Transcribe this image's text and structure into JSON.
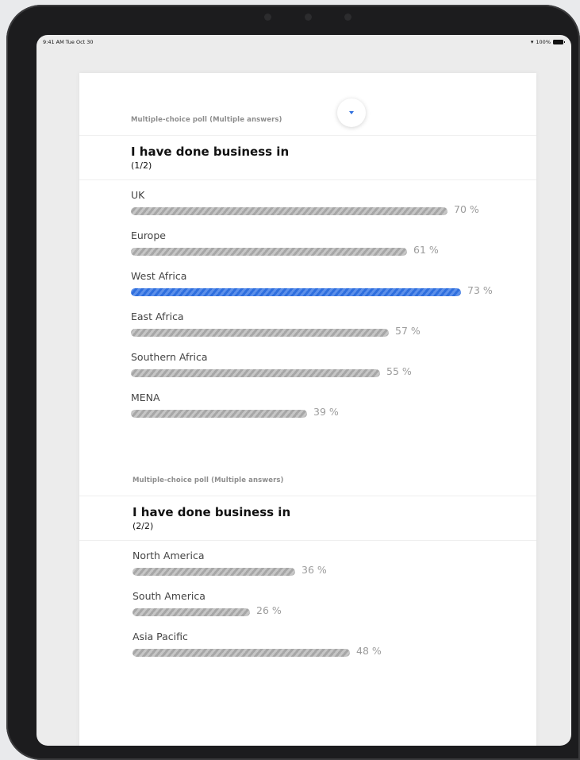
{
  "status_bar": {
    "time": "9:41 AM",
    "date": "Tue Oct 30",
    "battery": "100%",
    "wifi_icon": "wifi-icon",
    "battery_icon": "battery-icon"
  },
  "collapse_icon": "chevron-down-icon",
  "accent_color": "#2f6fde",
  "polls": [
    {
      "type_label": "Multiple-choice poll (Multiple answers)",
      "title": "I have done business in",
      "subtitle": "(1/2)",
      "options": [
        {
          "label": "UK",
          "percent": 70,
          "percent_text": "70 %",
          "selected": false
        },
        {
          "label": "Europe",
          "percent": 61,
          "percent_text": "61 %",
          "selected": false
        },
        {
          "label": "West Africa",
          "percent": 73,
          "percent_text": "73 %",
          "selected": true
        },
        {
          "label": "East Africa",
          "percent": 57,
          "percent_text": "57 %",
          "selected": false
        },
        {
          "label": "Southern Africa",
          "percent": 55,
          "percent_text": "55 %",
          "selected": false
        },
        {
          "label": "MENA",
          "percent": 39,
          "percent_text": "39 %",
          "selected": false
        }
      ]
    },
    {
      "type_label": "Multiple-choice poll (Multiple answers)",
      "title": "I have done business in",
      "subtitle": "(2/2)",
      "options": [
        {
          "label": "North America",
          "percent": 36,
          "percent_text": "36 %",
          "selected": false
        },
        {
          "label": "South America",
          "percent": 26,
          "percent_text": "26 %",
          "selected": false
        },
        {
          "label": "Asia Pacific",
          "percent": 48,
          "percent_text": "48 %",
          "selected": false
        }
      ]
    }
  ]
}
